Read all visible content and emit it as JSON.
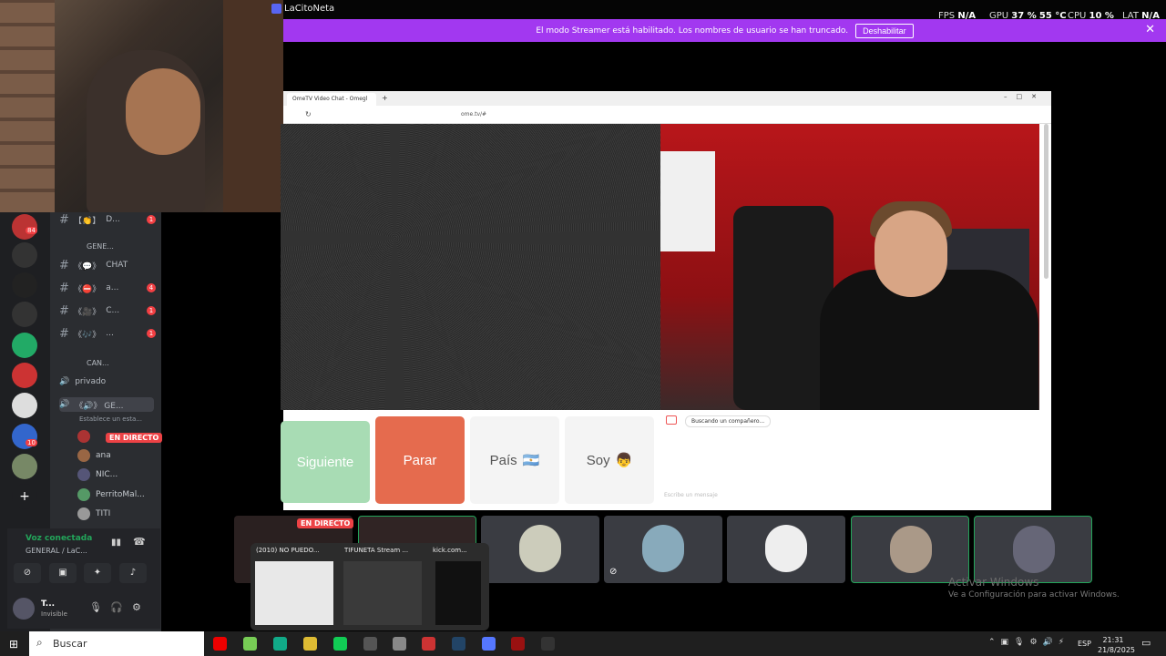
{
  "top": {
    "title": "LaCitoNeta",
    "fps_label": "FPS",
    "fps_value": "N/A",
    "gpu_label": "GPU",
    "gpu_value": "37 %",
    "gpu_temp": "55 °C",
    "cpu_label": "CPU",
    "cpu_value": "10 %",
    "lat_label": "LAT",
    "lat_value": "N/A"
  },
  "streamer_banner": {
    "text": "El modo Streamer está habilitado. Los nombres de usuario se han truncado.",
    "button": "Deshabilitar",
    "close": "✕"
  },
  "sidebar": {
    "guild_badges": [
      "84",
      "10"
    ],
    "channels": [
      {
        "icon": "【👏】",
        "label": "D...",
        "badge": "1"
      },
      {
        "icon": "",
        "label": "GENE...",
        "category": true
      },
      {
        "icon": "《💬》",
        "label": "CHAT",
        "badge": ""
      },
      {
        "icon": "《⛔》",
        "label": "a...",
        "badge": "4"
      },
      {
        "icon": "《🎥》",
        "label": "C...",
        "badge": "1"
      },
      {
        "icon": "《🎶》",
        "label": "...",
        "badge": "1"
      },
      {
        "icon": "",
        "label": "CAN...",
        "category": true
      }
    ],
    "voice_private": "privado",
    "voice_general_label": "《🔊》 GE...",
    "voice_general_status": "Establece un esta...",
    "live_badge": "EN DIRECTO",
    "voice_users": [
      "ana",
      "NIC...",
      "PerritoMal...",
      "TITI"
    ]
  },
  "voice_panel": {
    "status": "Voz conectada",
    "channel": "GENERAL / LaC...",
    "user_name": "T...",
    "user_status": "Invisible"
  },
  "browser": {
    "tab_title": "OmeTV Video Chat - Omegl",
    "url": "ome.tv/#",
    "searching": "Buscando un compañero...",
    "chat_placeholder": "Escribe un mensaje",
    "btn_next": "Siguiente",
    "btn_stop": "Parar",
    "btn_country": "País",
    "btn_country_flag": "🇦🇷",
    "btn_gender": "Soy",
    "btn_gender_icon": "👦"
  },
  "tiles": {
    "live_badge": "EN DIRECTO"
  },
  "taskbar_preview": [
    {
      "title": "(2010) NO PUEDO..."
    },
    {
      "title": "TIFUNETA Stream ..."
    },
    {
      "title": "kick.com..."
    }
  ],
  "watermark": {
    "line1": "Activar Windows",
    "line2": "Ve a Configuración para activar Windows."
  },
  "taskbar": {
    "search_placeholder": "Buscar",
    "lang": "ESP",
    "time": "21:31",
    "date": "21/8/2025"
  }
}
